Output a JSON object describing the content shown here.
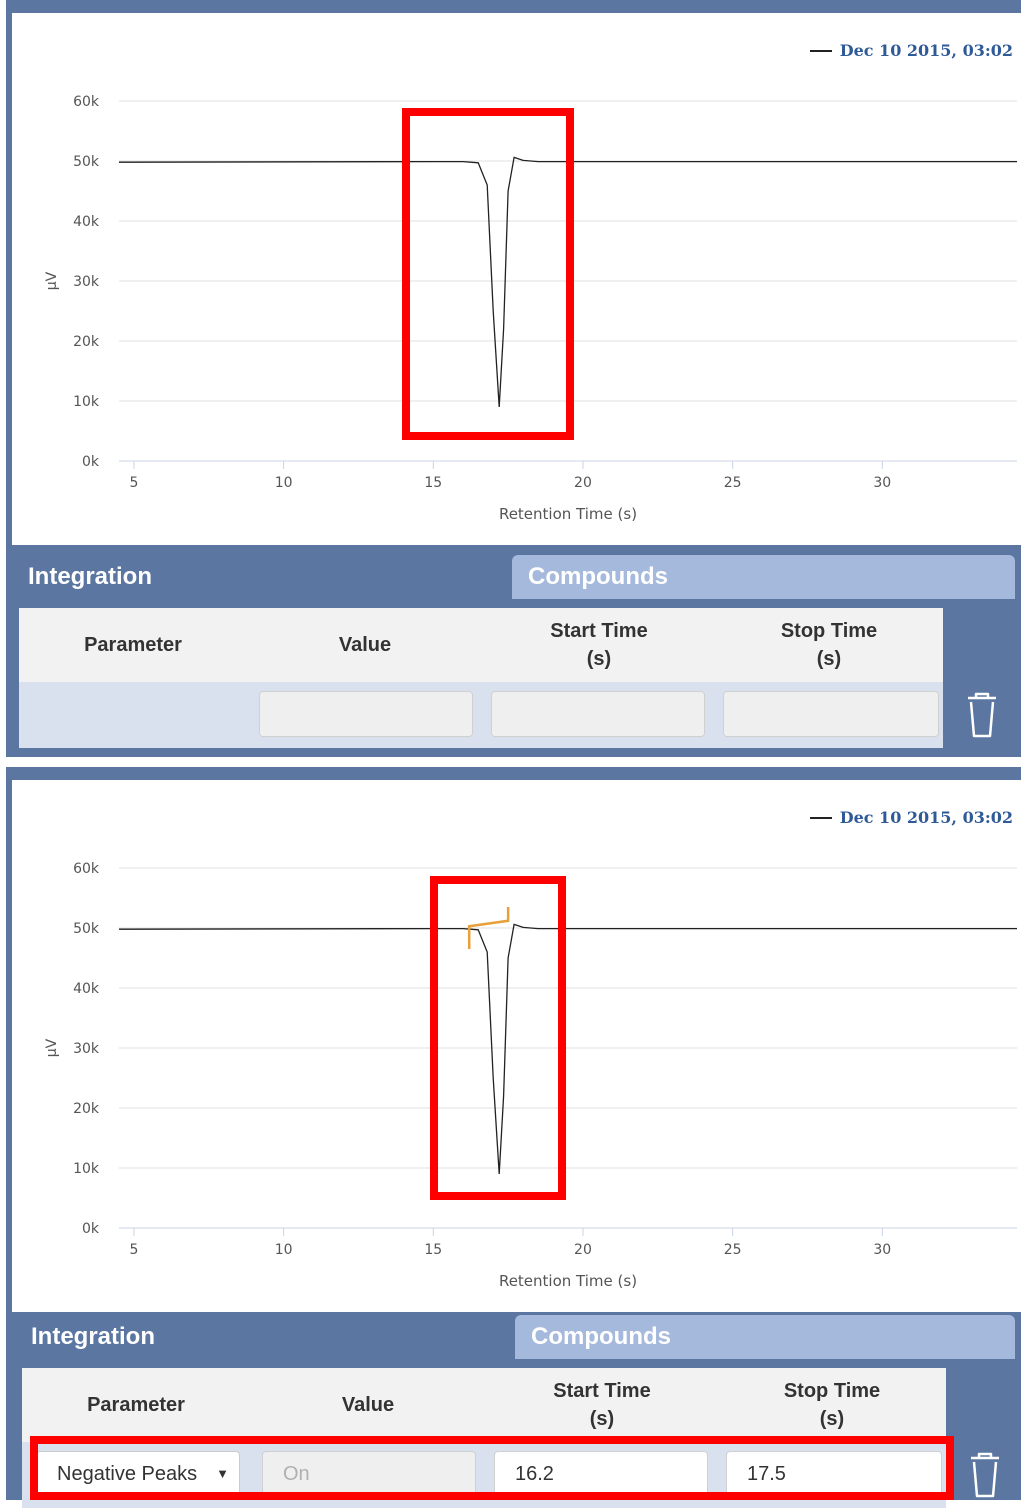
{
  "chart_data": [
    {
      "type": "line",
      "legend": "Dec 10 2015, 03:02",
      "xlabel": "Retention Time (s)",
      "ylabel": "µV",
      "xlim": [
        4.5,
        34.5
      ],
      "ylim": [
        0,
        60000
      ],
      "x_ticks": [
        "5",
        "10",
        "15",
        "20",
        "25",
        "30"
      ],
      "y_ticks": [
        "60k",
        "50k",
        "40k",
        "30k",
        "20k",
        "10k",
        "0k"
      ],
      "grid": true,
      "series": [
        {
          "x": [
            4.5,
            15.0,
            16.0,
            16.5,
            16.8,
            17.0,
            17.2,
            17.35,
            17.5,
            17.7,
            18.0,
            18.5,
            20.0,
            34.5
          ],
          "y": [
            49800,
            49900,
            49900,
            49700,
            46000,
            25000,
            9000,
            22000,
            45000,
            50600,
            50100,
            49900,
            49900,
            49900
          ]
        }
      ]
    },
    {
      "type": "line",
      "legend": "Dec 10 2015, 03:02",
      "xlabel": "Retention Time (s)",
      "ylabel": "µV",
      "xlim": [
        4.5,
        34.5
      ],
      "ylim": [
        0,
        60000
      ],
      "x_ticks": [
        "5",
        "10",
        "15",
        "20",
        "25",
        "30"
      ],
      "y_ticks": [
        "60k",
        "50k",
        "40k",
        "30k",
        "20k",
        "10k",
        "0k"
      ],
      "grid": true,
      "series": [
        {
          "x": [
            4.5,
            15.0,
            16.0,
            16.5,
            16.8,
            17.0,
            17.2,
            17.35,
            17.5,
            17.7,
            18.0,
            18.5,
            20.0,
            34.5
          ],
          "y": [
            49800,
            49900,
            49900,
            49700,
            46000,
            25000,
            9000,
            22000,
            45000,
            50600,
            50100,
            49900,
            49900,
            49900
          ]
        }
      ],
      "integration_marker": {
        "start": 16.2,
        "stop": 17.5,
        "color": "#e8a13a"
      }
    }
  ],
  "top": {
    "tabs": {
      "integration": "Integration",
      "compounds": "Compounds"
    },
    "headers": {
      "parameter": "Parameter",
      "value": "Value",
      "start": "Start Time\n(s)",
      "stop": "Stop Time\n(s)"
    }
  },
  "bottom": {
    "tabs": {
      "integration": "Integration",
      "compounds": "Compounds"
    },
    "headers": {
      "parameter": "Parameter",
      "value": "Value",
      "start": "Start Time\n(s)",
      "stop": "Stop Time\n(s)"
    },
    "row": {
      "parameter": "Negative Peaks",
      "value": "On",
      "start": "16.2",
      "stop": "17.5"
    }
  },
  "icons": {
    "trash": "trash-icon",
    "caret": "caret-down-icon"
  },
  "colors": {
    "panel": "#5b76a1",
    "tab_inactive": "#a5b9dd",
    "highlight": "#ff0000",
    "marker": "#e8a13a",
    "legend": "#2e5a98"
  }
}
